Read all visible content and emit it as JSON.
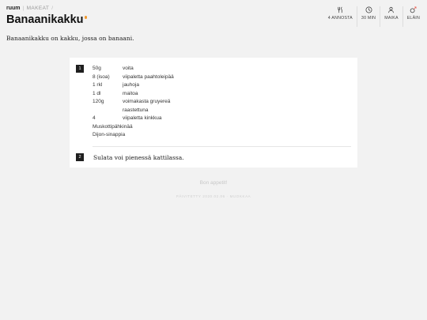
{
  "breadcrumb": {
    "logo": "ruum",
    "separator": "|",
    "category": "MAKEAT",
    "trail_separator": "/"
  },
  "title": "Banaanikakku",
  "meta": [
    {
      "icon": "fork-knife-icon",
      "label": "4 ANNOSTA"
    },
    {
      "icon": "clock-icon",
      "label": "30 MIN"
    },
    {
      "icon": "person-icon",
      "label": "MAIKA"
    },
    {
      "icon": "vegan-icon",
      "label": "ELÄIN"
    }
  ],
  "intro": "Banaanikakku on kakku, jossa on banaani.",
  "steps": [
    {
      "number": "1",
      "ingredients": [
        {
          "amount": "50g",
          "name": "voita"
        },
        {
          "amount": "8 (isoa)",
          "name": "viipaletta paahtoleipää"
        },
        {
          "amount": "1 rkl",
          "name": "jauhoja"
        },
        {
          "amount": "1 dl",
          "name": "maitoa"
        },
        {
          "amount": "120g",
          "name": "voimakasta gruyereä"
        },
        {
          "amount": "",
          "name": "raastettuna"
        },
        {
          "amount": "4",
          "name": "viipaletta kinkkua"
        },
        {
          "amount": "Muskottipähkinää",
          "name": ""
        },
        {
          "amount": "Dijon-sinappia",
          "name": ""
        }
      ]
    },
    {
      "number": "2",
      "text": "Sulata voi pienessä kattilassa."
    }
  ],
  "footer": {
    "message": "Bon appetit!",
    "published": "PÄIVITETTY 2020.02.06 · MUOKKAA"
  },
  "colors": {
    "accent": "#f29a2e",
    "background": "#f2f2f2",
    "card": "#ffffff",
    "badge": "#1f1f1f"
  }
}
